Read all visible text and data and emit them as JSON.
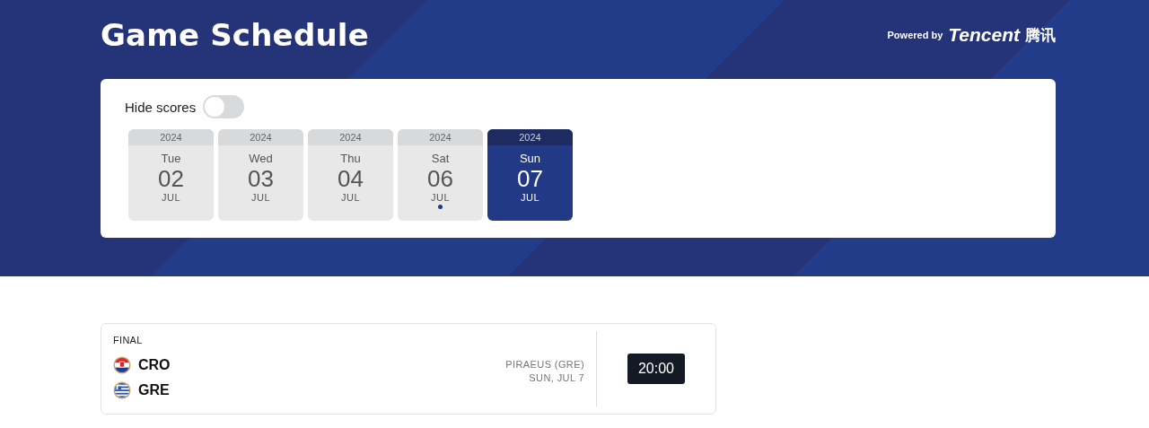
{
  "header": {
    "title": "Game Schedule",
    "powered_by": "Powered by",
    "brand": "Tencent",
    "brand_cn": "腾讯"
  },
  "hide_scores": {
    "label": "Hide scores",
    "on": false
  },
  "dates": [
    {
      "year": "2024",
      "weekday": "Tue",
      "day": "02",
      "month": "JUL",
      "selected": false,
      "has_games": false
    },
    {
      "year": "2024",
      "weekday": "Wed",
      "day": "03",
      "month": "JUL",
      "selected": false,
      "has_games": false
    },
    {
      "year": "2024",
      "weekday": "Thu",
      "day": "04",
      "month": "JUL",
      "selected": false,
      "has_games": false
    },
    {
      "year": "2024",
      "weekday": "Sat",
      "day": "06",
      "month": "JUL",
      "selected": false,
      "has_games": true
    },
    {
      "year": "2024",
      "weekday": "Sun",
      "day": "07",
      "month": "JUL",
      "selected": true,
      "has_games": false
    }
  ],
  "games": [
    {
      "stage": "FINAL",
      "teams": [
        {
          "code": "CRO"
        },
        {
          "code": "GRE"
        }
      ],
      "venue": "PIRAEUS (GRE)",
      "date": "SUN, JUL 7",
      "time": "20:00"
    }
  ]
}
